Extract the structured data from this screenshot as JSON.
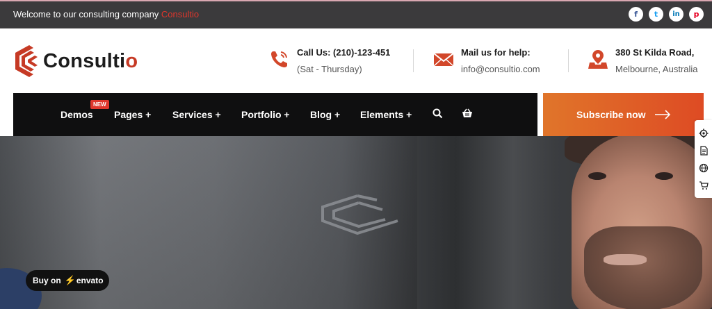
{
  "topbar": {
    "welcome_text": "Welcome to our consulting company ",
    "welcome_brand": "Consultio",
    "socials": [
      {
        "icon": "facebook-icon",
        "glyph": "f",
        "color": "#3b5998"
      },
      {
        "icon": "twitter-icon",
        "glyph": "t",
        "color": "#1da1f2"
      },
      {
        "icon": "linkedin-icon",
        "glyph": "in",
        "color": "#0077b5"
      },
      {
        "icon": "pinterest-icon",
        "glyph": "p",
        "color": "#e60023"
      }
    ]
  },
  "header": {
    "logo_text_main": "Consulti",
    "logo_text_accent": "o",
    "call": {
      "title": "Call Us: (210)-123-451",
      "subtitle": "(Sat - Thursday)",
      "icon": "phone-icon"
    },
    "mail": {
      "title": "Mail us for help:",
      "subtitle": "info@consultio.com",
      "icon": "mail-icon"
    },
    "address": {
      "title": "380 St Kilda Road,",
      "subtitle": "Melbourne, Australia",
      "icon": "location-icon"
    }
  },
  "nav": {
    "items": [
      "Demos",
      "Pages +",
      "Services +",
      "Portfolio +",
      "Blog +",
      "Elements +"
    ],
    "badge": "NEW",
    "search_icon": "search-icon",
    "cart_icon": "cart-icon",
    "subscribe_label": "Subscribe now"
  },
  "envato": {
    "prefix": "Buy on",
    "brand": "envato"
  },
  "side_tools": [
    "settings-icon",
    "document-icon",
    "globe-icon",
    "cart-icon"
  ],
  "colors": {
    "accent": "#e0362c",
    "cta": "#e0752a",
    "nav_bg": "#0f0f10",
    "topbar_bg": "#3b3a3c"
  }
}
